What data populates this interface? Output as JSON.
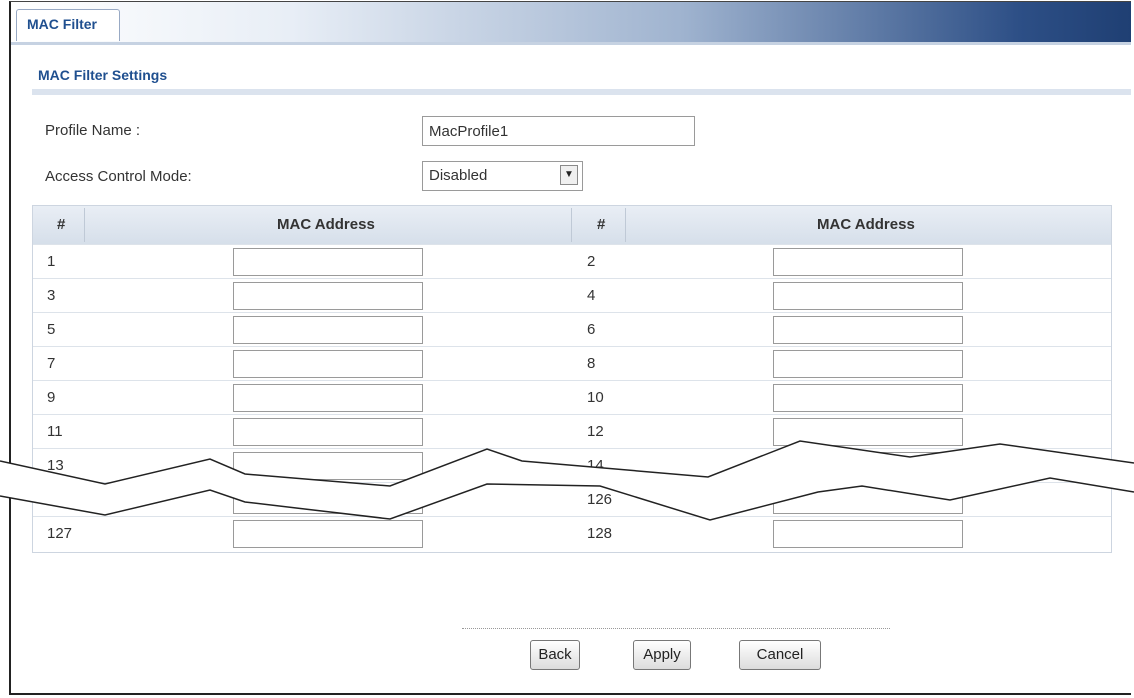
{
  "tab": {
    "label": "MAC Filter"
  },
  "section": {
    "title": "MAC Filter Settings"
  },
  "form": {
    "profile_name_label": "Profile Name :",
    "profile_name_value": "MacProfile1",
    "access_mode_label": "Access Control Mode:",
    "access_mode_value": "Disabled"
  },
  "table": {
    "headers": [
      "#",
      "MAC Address",
      "#",
      "MAC Address"
    ],
    "rows": [
      {
        "left_no": "1",
        "right_no": "2"
      },
      {
        "left_no": "3",
        "right_no": "4"
      },
      {
        "left_no": "5",
        "right_no": "6"
      },
      {
        "left_no": "7",
        "right_no": "8"
      },
      {
        "left_no": "9",
        "right_no": "10"
      },
      {
        "left_no": "11",
        "right_no": "12"
      },
      {
        "left_no": "13",
        "right_no": "14"
      },
      {
        "left_no": "",
        "right_no": "126"
      },
      {
        "left_no": "127",
        "right_no": "128"
      }
    ]
  },
  "buttons": {
    "back": "Back",
    "apply": "Apply",
    "cancel": "Cancel"
  }
}
